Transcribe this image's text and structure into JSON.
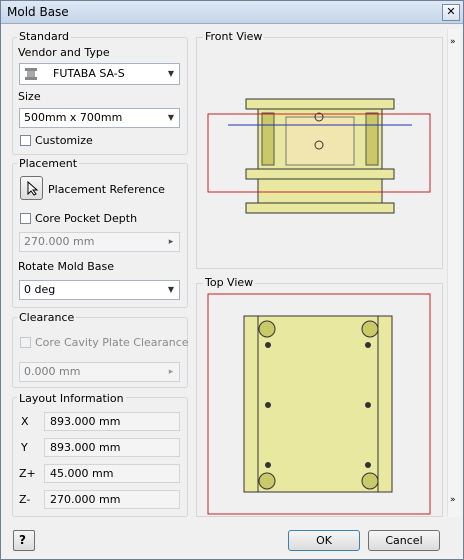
{
  "window": {
    "title": "Mold Base"
  },
  "standard": {
    "group_label": "Standard",
    "vendor_label": "Vendor and Type",
    "vendor_value": "FUTABA SA-S",
    "size_label": "Size",
    "size_value": "500mm x 700mm",
    "customize_label": "Customize"
  },
  "placement": {
    "group_label": "Placement",
    "reference_label": "Placement Reference",
    "core_pocket_label": "Core Pocket Depth",
    "core_pocket_value": "270.000 mm",
    "rotate_label": "Rotate Mold Base",
    "rotate_value": "0 deg"
  },
  "clearance": {
    "group_label": "Clearance",
    "core_cavity_label": "Core Cavity Plate Clearance",
    "value": "0.000 mm"
  },
  "layout": {
    "group_label": "Layout Information",
    "rows": [
      {
        "label": "X",
        "value": "893.000 mm"
      },
      {
        "label": "Y",
        "value": "893.000 mm"
      },
      {
        "label": "Z+",
        "value": "45.000 mm"
      },
      {
        "label": "Z-",
        "value": "270.000 mm"
      }
    ]
  },
  "views": {
    "front_label": "Front View",
    "top_label": "Top View"
  },
  "footer": {
    "ok": "OK",
    "cancel": "Cancel"
  },
  "colors": {
    "plate": "#e8e8a0",
    "outline": "#333333",
    "bbox": "#cc2222",
    "axis": "#2233aa"
  }
}
